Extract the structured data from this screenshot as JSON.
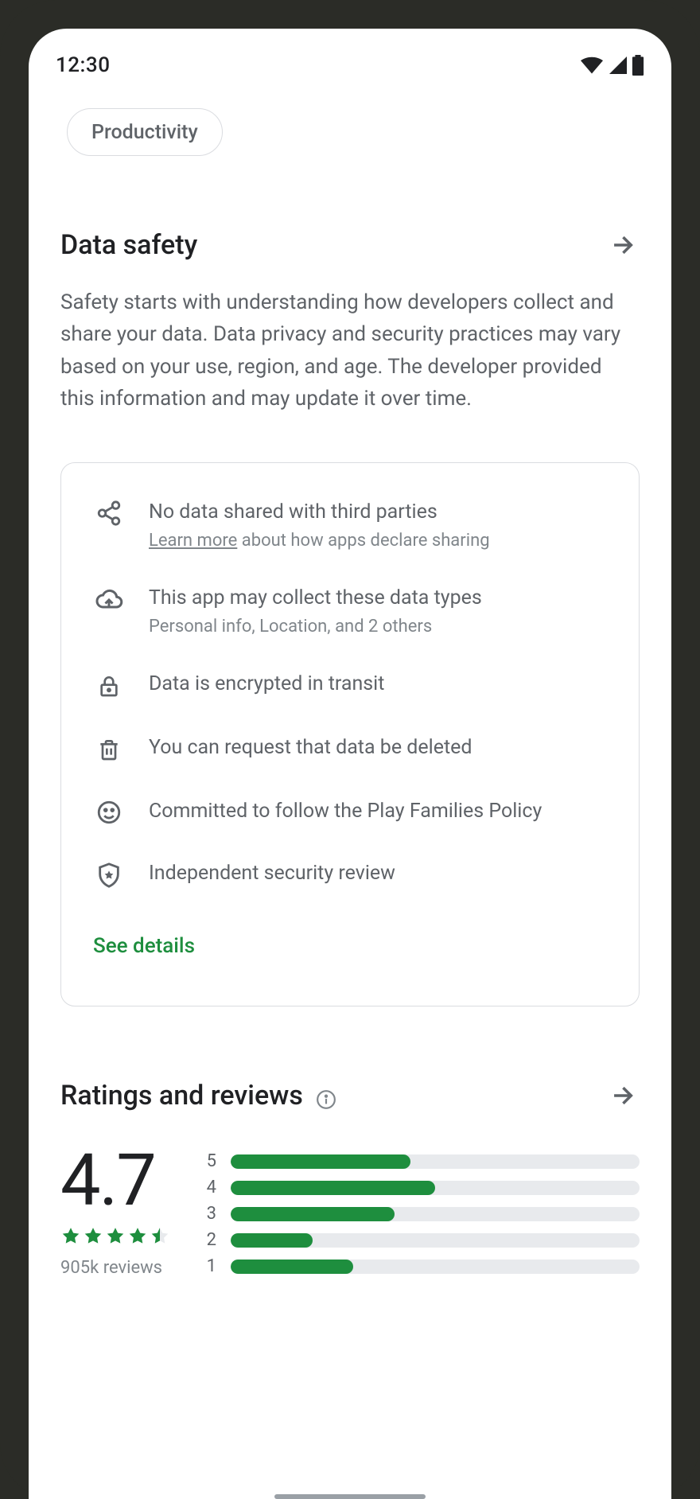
{
  "statusbar": {
    "time": "12:30"
  },
  "chip": {
    "label": "Productivity"
  },
  "data_safety": {
    "title": "Data safety",
    "body": "Safety starts with understanding how developers collect and share your data. Data privacy and security practices may vary based on your use, region, and age. The developer provided this information and may update it over time.",
    "items": [
      {
        "icon": "share",
        "title": "No data shared with third parties",
        "sub_link": "Learn more",
        "sub_rest": " about how apps declare sharing"
      },
      {
        "icon": "cloud-upload",
        "title": "This app may collect these data types",
        "sub": "Personal info, Location, and 2 others"
      },
      {
        "icon": "lock",
        "title": "Data is encrypted in transit"
      },
      {
        "icon": "trash",
        "title": "You can request that data be deleted"
      },
      {
        "icon": "smiley",
        "title": "Committed to follow the Play Families Policy"
      },
      {
        "icon": "shield-star",
        "title": "Independent security review"
      }
    ],
    "see_details": "See details"
  },
  "ratings": {
    "title": "Ratings and reviews",
    "average": "4.7",
    "stars": 4.5,
    "review_count": "905k  reviews",
    "bars": [
      {
        "label": "5",
        "pct": 44
      },
      {
        "label": "4",
        "pct": 50
      },
      {
        "label": "3",
        "pct": 40
      },
      {
        "label": "2",
        "pct": 20
      },
      {
        "label": "1",
        "pct": 30
      }
    ]
  },
  "colors": {
    "accent_green": "#1e8e3e",
    "text_primary": "#202124",
    "text_secondary": "#5f6368",
    "border": "#dadce0",
    "bar_track": "#e8eaed"
  }
}
